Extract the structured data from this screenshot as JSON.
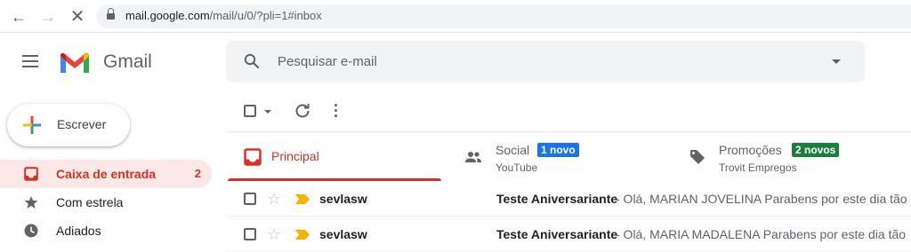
{
  "browser": {
    "url_host": "mail.google.com",
    "url_path": "/mail/u/0/?pli=1#inbox"
  },
  "header": {
    "product_name": "Gmail",
    "search_placeholder": "Pesquisar e-mail"
  },
  "sidebar": {
    "compose_label": "Escrever",
    "items": [
      {
        "label": "Caixa de entrada",
        "count": "2",
        "icon": "inbox-icon",
        "active": true
      },
      {
        "label": "Com estrela",
        "count": "",
        "icon": "star-icon",
        "active": false
      },
      {
        "label": "Adiados",
        "count": "",
        "icon": "clock-icon",
        "active": false
      }
    ]
  },
  "tabs": [
    {
      "label": "Principal",
      "sub": "",
      "badge": "",
      "active": true
    },
    {
      "label": "Social",
      "sub": "YouTube",
      "badge": "1 novo",
      "badge_color": "#1a73e8"
    },
    {
      "label": "Promoções",
      "sub": "Trovit Empregos",
      "badge": "2 novos",
      "badge_color": "#188038"
    }
  ],
  "emails": [
    {
      "sender": "sevlasw",
      "subject": "Teste Aniversariante",
      "snippet": " - Olá, MARIAN JOVELINA Parabens por este dia tão"
    },
    {
      "sender": "sevlasw",
      "subject": "Teste Aniversariante",
      "snippet": " - Olá, MARIA MADALENA Parabens por este dia tão"
    }
  ],
  "colors": {
    "accent": "#d93025",
    "social_badge": "#1a73e8",
    "promo_badge": "#188038"
  }
}
